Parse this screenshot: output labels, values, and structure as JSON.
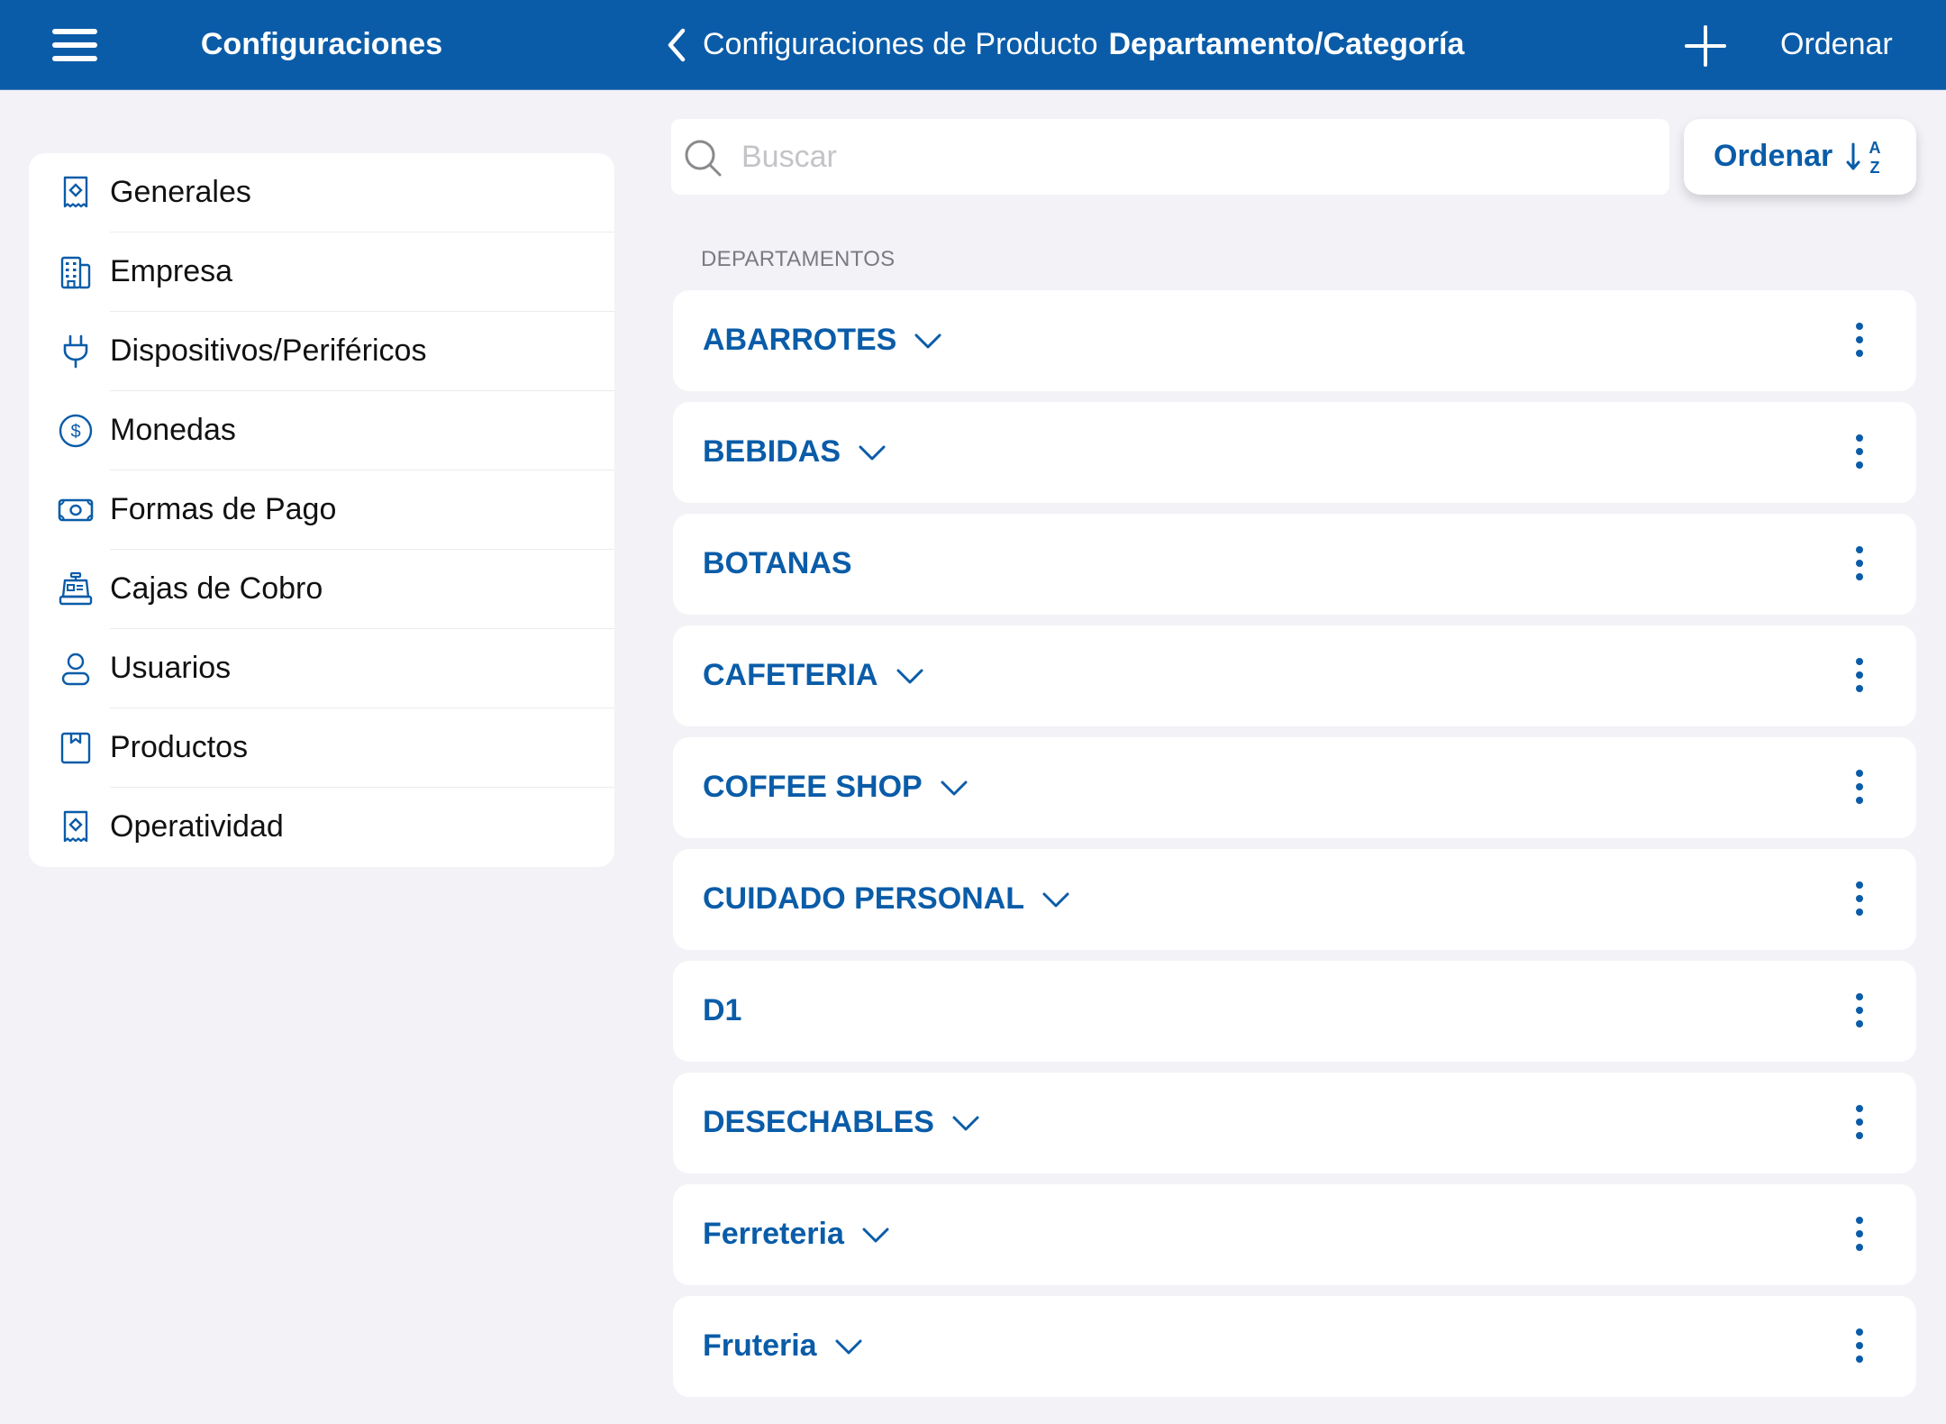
{
  "header": {
    "sidebar_title": "Configuraciones",
    "breadcrumb_parent": "Configuraciones de Producto",
    "breadcrumb_current": "Departamento/Categoría",
    "add_icon": "plus-icon",
    "ordenar_label": "Ordenar"
  },
  "sidebar": {
    "items": [
      {
        "label": "Generales",
        "icon": "receipt-icon"
      },
      {
        "label": "Empresa",
        "icon": "building-icon"
      },
      {
        "label": "Dispositivos/Periféricos",
        "icon": "plug-icon"
      },
      {
        "label": "Monedas",
        "icon": "dollar-circle-icon"
      },
      {
        "label": "Formas de Pago",
        "icon": "banknote-icon"
      },
      {
        "label": "Cajas de Cobro",
        "icon": "cash-register-icon"
      },
      {
        "label": "Usuarios",
        "icon": "user-icon"
      },
      {
        "label": "Productos",
        "icon": "product-box-icon"
      },
      {
        "label": "Operatividad",
        "icon": "receipt-icon"
      }
    ]
  },
  "search": {
    "placeholder": "Buscar",
    "value": ""
  },
  "sort_button": {
    "label": "Ordenar",
    "icon": "sort-a-z-icon"
  },
  "section_label": "DEPARTAMENTOS",
  "departments": [
    {
      "name": "ABARROTES",
      "expandable": true
    },
    {
      "name": "BEBIDAS",
      "expandable": true
    },
    {
      "name": "BOTANAS",
      "expandable": false
    },
    {
      "name": "CAFETERIA",
      "expandable": true
    },
    {
      "name": "COFFEE SHOP",
      "expandable": true
    },
    {
      "name": "CUIDADO PERSONAL",
      "expandable": true
    },
    {
      "name": "D1",
      "expandable": false
    },
    {
      "name": "DESECHABLES",
      "expandable": true
    },
    {
      "name": "Ferreteria",
      "expandable": true
    },
    {
      "name": "Fruteria",
      "expandable": true
    }
  ],
  "colors": {
    "brand_blue": "#0A5CA8",
    "background": "#F2F2F7"
  }
}
